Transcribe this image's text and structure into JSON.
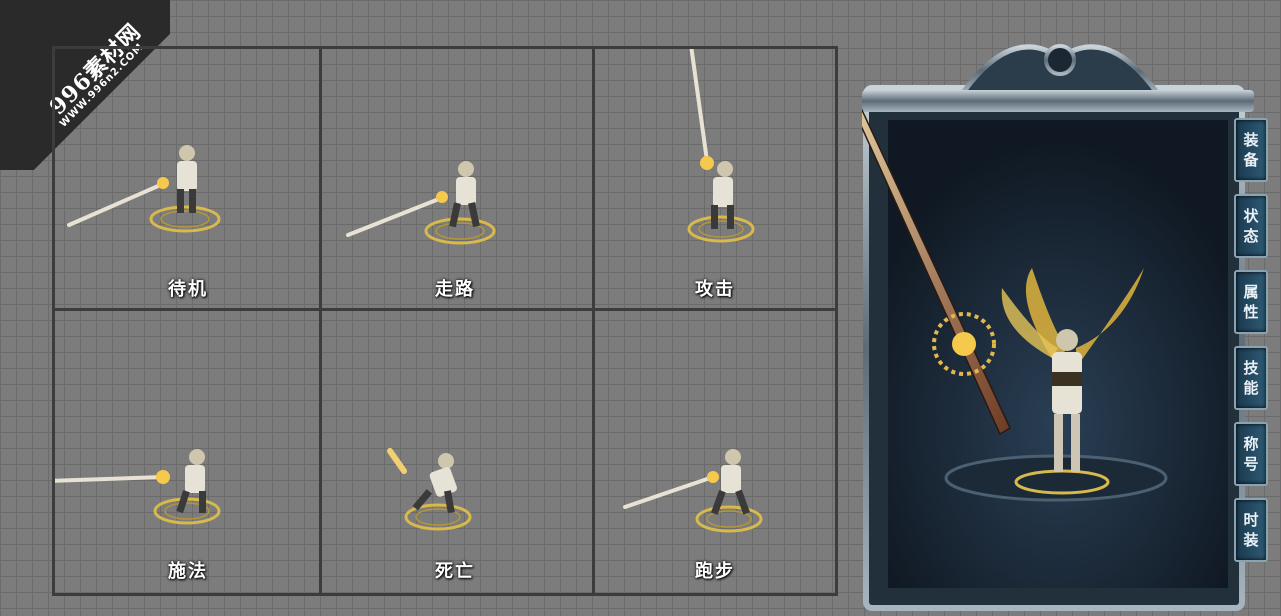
{
  "watermark": {
    "site": "996素材网",
    "url": "WWW.996n2.COM"
  },
  "animations": [
    {
      "label": "待机"
    },
    {
      "label": "走路"
    },
    {
      "label": "攻击"
    },
    {
      "label": "施法"
    },
    {
      "label": "死亡"
    },
    {
      "label": "跑步"
    }
  ],
  "panel": {
    "tabs": [
      {
        "line1": "装",
        "line2": "备"
      },
      {
        "line1": "状",
        "line2": "态"
      },
      {
        "line1": "属",
        "line2": "性"
      },
      {
        "line1": "技",
        "line2": "能"
      },
      {
        "line1": "称",
        "line2": "号"
      },
      {
        "line1": "时",
        "line2": "装"
      }
    ]
  },
  "colors": {
    "background": "#7c7c7c",
    "grid_line": "#3c3c3c",
    "panel_bg": "#16212c",
    "gold": "#e3b84a",
    "tab_bg": "#234a61"
  }
}
